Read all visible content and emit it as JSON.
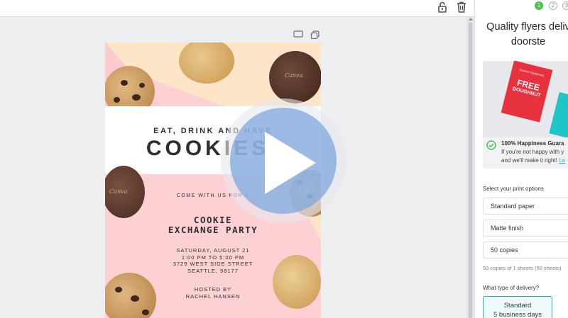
{
  "toolbar": {
    "lock_icon": "lock-icon",
    "trash_icon": "trash-icon"
  },
  "page_tools": {
    "comment_icon": "comment-icon",
    "duplicate_icon": "duplicate-icon"
  },
  "flyer": {
    "headline_small": "EAT, DRINK AND HAVE",
    "headline_big": "COOKIES!",
    "invite": "COME WITH US FOR A",
    "event_line1": "COOKIE",
    "event_line2": "EXCHANGE PARTY",
    "details": [
      "SATURDAY, AUGUST 21",
      "1:00 PM TO 5:00 PM",
      "3729 WEST SIDE STREET",
      "SEATTLE, 98177"
    ],
    "hosted_label": "HOSTED BY",
    "host": "RACHEL HANSEN",
    "cookie_brand": "Canva"
  },
  "video": {
    "play_icon": "play-icon"
  },
  "panel": {
    "steps": [
      "1",
      "2",
      "3"
    ],
    "title_line1": "Quality flyers deliv",
    "title_line2": "doorste",
    "promo": {
      "line1": "FREE",
      "line2": "DOUGHNUT",
      "brand": "Summer Doughnuts"
    },
    "happiness_title": "100% Happiness Guara",
    "happiness_line1": "If you're not happy with y",
    "happiness_line2": "and we'll make it right!",
    "happiness_link": "Le",
    "print_options_label": "Select your print options",
    "paper": "Standard paper",
    "finish": "Matte finish",
    "copies": "50 copies",
    "copies_note": "50 copies of 1 sheets (50 sheets)",
    "delivery_label": "What type of delivery?",
    "delivery_option": "Standard",
    "delivery_time": "5 business days"
  },
  "colors": {
    "accent_green": "#4ec24c",
    "accent_teal": "#1fbcb8",
    "flyer_pink": "#fdd0d3",
    "flyer_cream": "#fde6c8",
    "play_blue": "#7fa8de"
  }
}
